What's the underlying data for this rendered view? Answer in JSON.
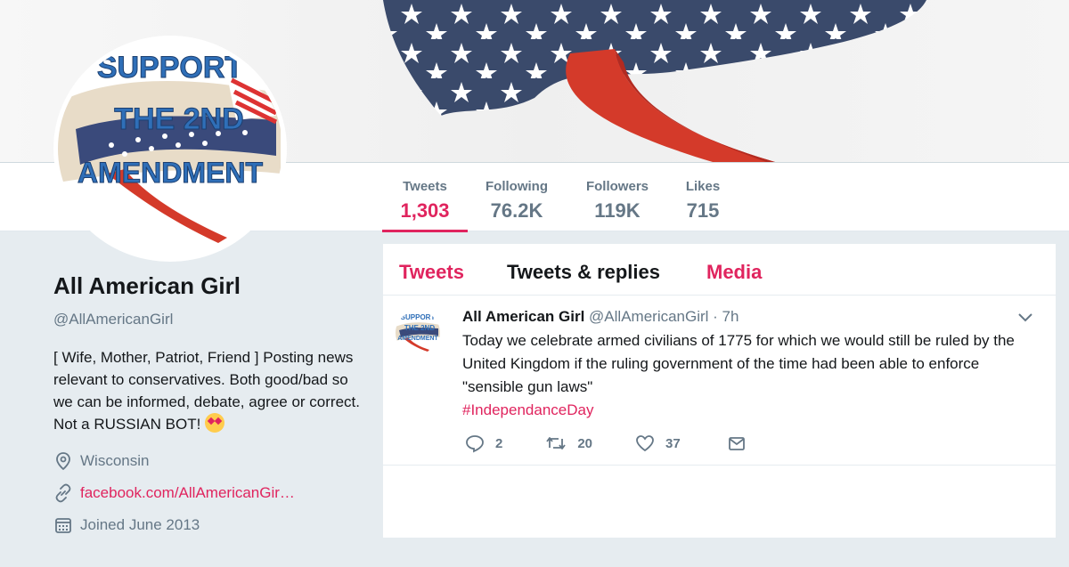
{
  "avatar_text": {
    "line1": "SUPPORT",
    "line2": "THE 2ND",
    "line3": "AMENDMENT"
  },
  "stats": [
    {
      "label": "Tweets",
      "value": "1,303"
    },
    {
      "label": "Following",
      "value": "76.2K"
    },
    {
      "label": "Followers",
      "value": "119K"
    },
    {
      "label": "Likes",
      "value": "715"
    }
  ],
  "profile": {
    "name": "All American Girl",
    "handle": "@AllAmericanGirl",
    "bio": "[ Wife, Mother, Patriot, Friend ] Posting news relevant to conservatives. Both good/bad so we can be informed, debate, agree or correct. Not a RUSSIAN BOT!",
    "location": "Wisconsin",
    "website": "facebook.com/AllAmericanGir…",
    "joined": "Joined June 2013"
  },
  "tabs": [
    "Tweets",
    "Tweets & replies",
    "Media"
  ],
  "tweet": {
    "name": "All American Girl",
    "handle": "@AllAmericanGirl",
    "time": "· 7h",
    "text": "Today we celebrate armed civilians of 1775 for which we would still be ruled by the United Kingdom if the ruling government of the time had been able to enforce \"sensible gun laws\"",
    "hashtag": "#IndependanceDay",
    "replies": "2",
    "retweets": "20",
    "likes": "37"
  },
  "colors": {
    "accent": "#e0245e",
    "muted": "#657786",
    "text": "#14171a",
    "background": "#e6ecf0"
  },
  "icons": {
    "location": "location-pin-icon",
    "link": "link-icon",
    "calendar": "calendar-icon",
    "reply": "reply-icon",
    "retweet": "retweet-icon",
    "like": "heart-icon",
    "dm": "envelope-icon",
    "chevron": "chevron-down-icon"
  }
}
